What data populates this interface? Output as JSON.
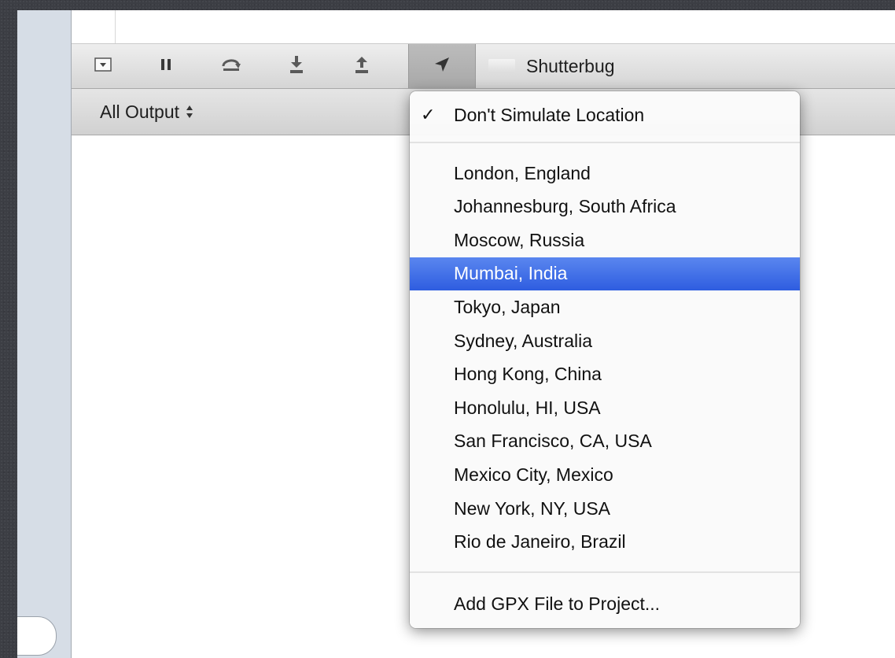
{
  "toolbar": {
    "buttons": [
      {
        "icon": "hide-console-icon"
      },
      {
        "icon": "pause-icon"
      },
      {
        "icon": "step-over-icon"
      },
      {
        "icon": "step-into-icon"
      },
      {
        "icon": "step-out-icon"
      },
      {
        "icon": "location-arrow-icon"
      }
    ],
    "process_name": "Shutterbug"
  },
  "output_bar": {
    "selector_label": "All Output"
  },
  "location_menu": {
    "checked_item": "Don't Simulate Location",
    "checkmark": "✓",
    "locations": [
      "London, England",
      "Johannesburg, South Africa",
      "Moscow, Russia",
      "Mumbai, India",
      "Tokyo, Japan",
      "Sydney, Australia",
      "Hong Kong, China",
      "Honolulu, HI, USA",
      "San Francisco, CA, USA",
      "Mexico City, Mexico",
      "New York, NY, USA",
      "Rio de Janeiro, Brazil"
    ],
    "highlighted_location": "Mumbai, India",
    "add_gpx_label": "Add GPX File to Project..."
  },
  "colors": {
    "highlight": "#3a68e6",
    "toolbar_icon": "#4a4a4a"
  }
}
